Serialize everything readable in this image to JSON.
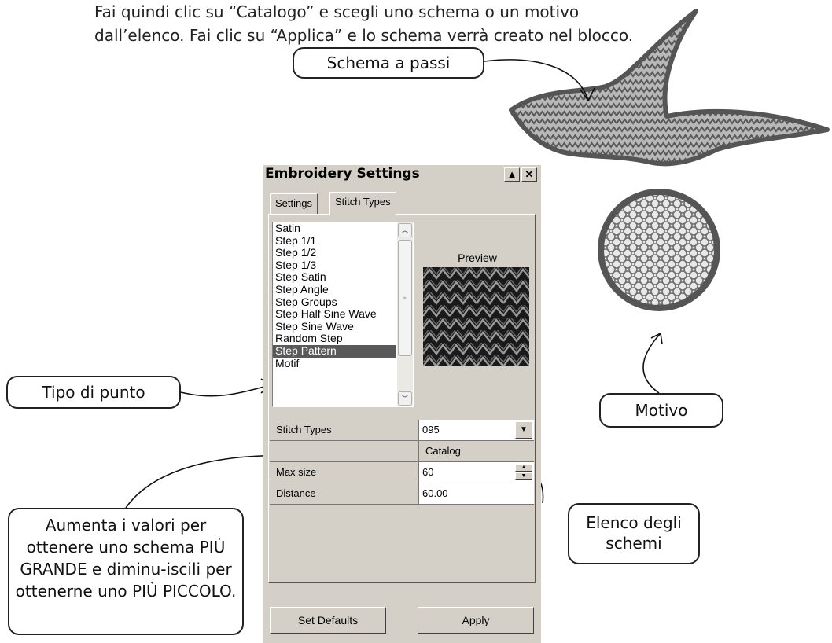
{
  "intro": {
    "line1": "Fai quindi clic su “Catalogo” e scegli uno schema o un motivo",
    "line2": "dall’elenco. Fai clic su “Applica” e lo schema verrà creato nel blocco."
  },
  "callouts": {
    "schema": "Schema a passi",
    "tipo": "Tipo di punto",
    "motivo": "Motivo",
    "elenco": "Elenco degli schemi",
    "aumenta": "Aumenta i valori per ottenere uno schema PIÙ GRANDE e diminu-iscili per ottenerne uno PIÙ PICCOLO."
  },
  "dialog": {
    "title": "Embroidery Settings",
    "tabs": [
      "Settings",
      "Stitch Types"
    ],
    "active_tab": "Stitch Types",
    "list_items": [
      "Satin",
      "Step 1/1",
      "Step 1/2",
      "Step 1/3",
      "Step Satin",
      "Step Angle",
      "Step Groups",
      "Step Half Sine Wave",
      "Step Sine Wave",
      "Random Step",
      "Step Pattern",
      "Motif"
    ],
    "selected_item": "Step Pattern",
    "preview_label": "Preview",
    "properties": [
      {
        "name": "Stitch Types",
        "value": "095",
        "control": "dropdown"
      },
      {
        "name": "",
        "value": "Catalog",
        "control": "button"
      },
      {
        "name": "Max size",
        "value": "60",
        "control": "spinner"
      },
      {
        "name": "Distance",
        "value": "60.00",
        "control": "none"
      }
    ],
    "buttons": {
      "defaults": "Set Defaults",
      "apply": "Apply"
    }
  },
  "icons": {
    "minimize": "triangle-up-icon",
    "close": "close-icon",
    "scroll_up": "chevron-up-icon",
    "scroll_down": "chevron-down-icon",
    "scroll_grip": "grip-icon",
    "dropdown": "chevron-down-icon",
    "spin_up": "triangle-up-icon",
    "spin_down": "triangle-down-icon"
  },
  "colors": {
    "dialog_face": "#d4d0c8",
    "selection": "#595959",
    "embroidery_border": "#555555",
    "embroidery_fill": "#a8a8a8"
  }
}
